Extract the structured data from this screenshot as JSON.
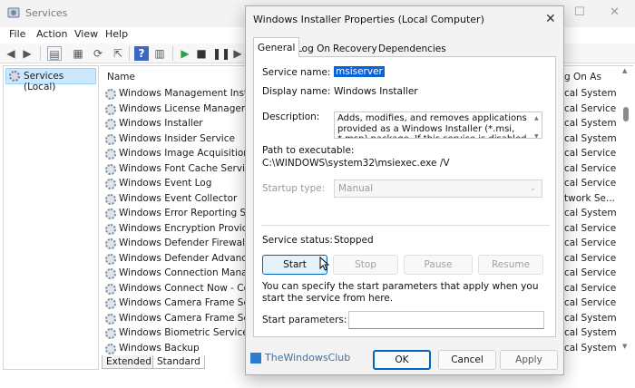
{
  "services_window": {
    "title": "Services",
    "menu": [
      "File",
      "Action",
      "View",
      "Help"
    ],
    "tree_item": "Services (Local)",
    "columns": {
      "name": "Name",
      "logon": "g On As"
    },
    "rows": [
      {
        "name": "Windows Management Instrum",
        "logon": "cal System"
      },
      {
        "name": "Windows License Manager Serv",
        "logon": "cal Service"
      },
      {
        "name": "Windows Installer",
        "logon": "cal System"
      },
      {
        "name": "Windows Insider Service",
        "logon": "cal System"
      },
      {
        "name": "Windows Image Acquisition (W",
        "logon": "cal Service"
      },
      {
        "name": "Windows Font Cache Service",
        "logon": "cal Service"
      },
      {
        "name": "Windows Event Log",
        "logon": "cal Service"
      },
      {
        "name": "Windows Event Collector",
        "logon": "twork Se..."
      },
      {
        "name": "Windows Error Reporting Servi",
        "logon": "cal System"
      },
      {
        "name": "Windows Encryption Provider H",
        "logon": "cal Service"
      },
      {
        "name": "Windows Defender Firewall",
        "logon": "cal Service"
      },
      {
        "name": "Windows Defender Advanced T",
        "logon": "cal Service"
      },
      {
        "name": "Windows Connection Manager",
        "logon": "cal Service"
      },
      {
        "name": "Windows Connect Now - Confi",
        "logon": "cal Service"
      },
      {
        "name": "Windows Camera Frame Server",
        "logon": "cal Service"
      },
      {
        "name": "Windows Camera Frame Server",
        "logon": "cal System"
      },
      {
        "name": "Windows Biometric Service",
        "logon": "cal System"
      },
      {
        "name": "Windows Backup",
        "logon": "cal System"
      }
    ],
    "view_tabs": [
      "Extended",
      "Standard"
    ]
  },
  "dialog": {
    "title": "Windows Installer Properties (Local Computer)",
    "tabs": [
      "General",
      "Log On",
      "Recovery",
      "Dependencies"
    ],
    "service_name_label": "Service name:",
    "service_name": "msiserver",
    "display_name_label": "Display name:",
    "display_name": "Windows Installer",
    "description_label": "Description:",
    "description": "Adds, modifies, and removes applications provided as a Windows Installer (*.msi, *.msp) package. If this service is disabled, any services that explicitly depend",
    "path_label": "Path to executable:",
    "path": "C:\\WINDOWS\\system32\\msiexec.exe /V",
    "startup_type_label": "Startup type:",
    "startup_type": "Manual",
    "status_label": "Service status:",
    "status": "Stopped",
    "buttons": {
      "start": "Start",
      "stop": "Stop",
      "pause": "Pause",
      "resume": "Resume"
    },
    "params_help": "You can specify the start parameters that apply when you start the service from here.",
    "params_label": "Start parameters:",
    "params_value": "",
    "footer": {
      "ok": "OK",
      "cancel": "Cancel",
      "apply": "Apply"
    }
  },
  "watermark": "TheWindowsClub",
  "icons": {
    "app": "services-icon",
    "service": "gear-icon",
    "cursor": "mouse-pointer-icon"
  }
}
